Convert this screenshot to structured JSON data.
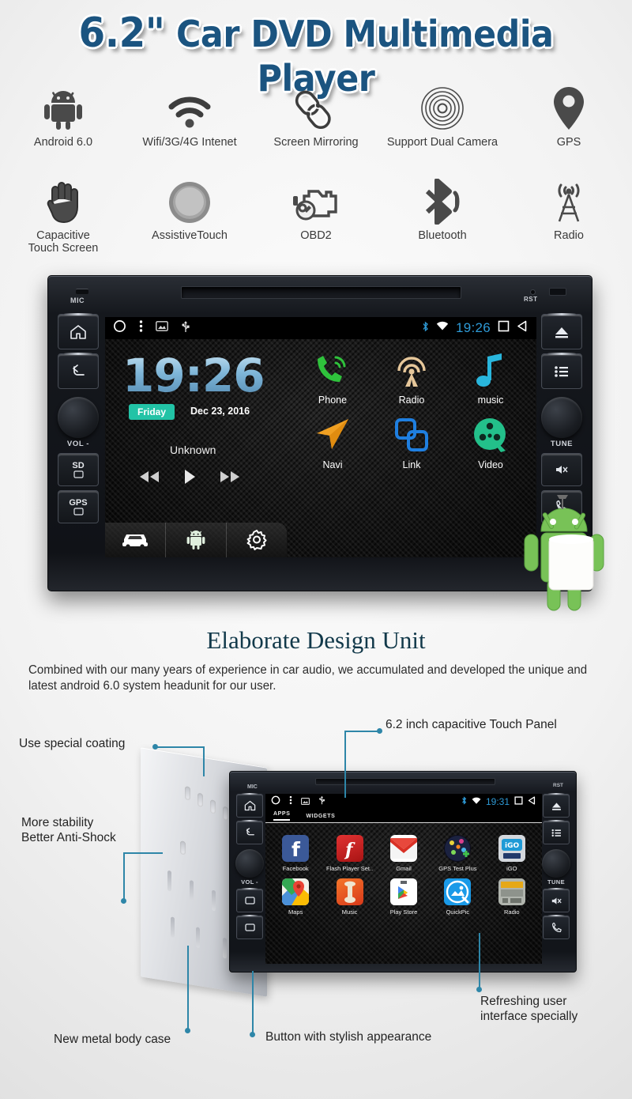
{
  "header": {
    "size": "6.2\"",
    "title": "Car DVD Multimedia Player"
  },
  "features_row1": [
    {
      "icon": "android-robot-icon",
      "label": "Android 6.0"
    },
    {
      "icon": "wifi-icon",
      "label": "Wifi/3G/4G Intenet"
    },
    {
      "icon": "chain-link-icon",
      "label": "Screen Mirroring"
    },
    {
      "icon": "camera-rings-icon",
      "label": "Support Dual Camera"
    },
    {
      "icon": "map-pin-icon",
      "label": "GPS"
    }
  ],
  "features_row2": [
    {
      "icon": "hand-touch-icon",
      "label": "Capacitive\nTouch Screen",
      "line1": "Capacitive",
      "line2": "Touch Screen"
    },
    {
      "icon": "round-button-icon",
      "label": "AssistiveTouch",
      "line1": "AssistiveTouch",
      "line2": ""
    },
    {
      "icon": "engine-wrench-icon",
      "label": "OBD2",
      "line1": "OBD2",
      "line2": ""
    },
    {
      "icon": "bluetooth-icon",
      "label": "Bluetooth",
      "line1": "Bluetooth",
      "line2": ""
    },
    {
      "icon": "radio-tower-icon",
      "label": "Radio",
      "line1": "Radio",
      "line2": ""
    }
  ],
  "device": {
    "mic_label": "MIC",
    "rst_label": "RST",
    "left_buttons": [
      {
        "name": "home-button",
        "icon": "home-icon"
      },
      {
        "name": "back-button",
        "icon": "back-arrow-icon"
      }
    ],
    "left_knob_label": "VOL -",
    "left_slots": [
      {
        "name": "sd-card-slot",
        "label": "SD"
      },
      {
        "name": "gps-slot",
        "label": "GPS"
      }
    ],
    "right_buttons": [
      {
        "name": "eject-button",
        "icon": "eject-icon"
      },
      {
        "name": "list-button",
        "icon": "list-icon"
      }
    ],
    "right_knob_label": "TUNE"
  },
  "screen": {
    "status_bar": {
      "left_icons": [
        "circle-icon",
        "kebab-menu-icon",
        "image-icon",
        "usb-icon"
      ],
      "right_icons": [
        "bluetooth-icon",
        "wifi-icon"
      ],
      "time": "19:26",
      "nav_icons": [
        "square-icon",
        "back-triangle-icon"
      ]
    },
    "clock": "19:26",
    "day_badge": "Friday",
    "date": "Dec 23, 2016",
    "track_name": "Unknown",
    "transport": [
      "rewind-icon",
      "play-icon",
      "forward-icon"
    ],
    "apps": [
      {
        "icon": "phone-handset-icon",
        "label": "Phone",
        "color": "#2fc23c"
      },
      {
        "icon": "radio-waves-icon",
        "label": "Radio",
        "color": "#e6c79a"
      },
      {
        "icon": "music-note-icon",
        "label": "music",
        "color": "#29b6dd"
      },
      {
        "icon": "navigation-arrow-icon",
        "label": "Navi",
        "color": "#f0a022"
      },
      {
        "icon": "link-squares-icon",
        "label": "Link",
        "color": "#1f7fe0"
      },
      {
        "icon": "film-reel-icon",
        "label": "Video",
        "color": "#23c08a"
      }
    ],
    "tabs": [
      {
        "name": "tab-car",
        "icon": "car-icon"
      },
      {
        "name": "tab-android",
        "icon": "android-robot-icon"
      },
      {
        "name": "tab-settings",
        "icon": "gear-icon"
      }
    ]
  },
  "design_section": {
    "title": "Elaborate Design Unit",
    "body": "Combined with our many years of experience in car audio, we accumulated and developed the unique and latest android 6.0 system headunit for our user."
  },
  "exploded": {
    "status_bar": {
      "left_icons": [
        "circle-icon",
        "kebab-menu-icon",
        "image-icon",
        "usb-icon"
      ],
      "right_icons": [
        "bluetooth-icon",
        "wifi-icon"
      ],
      "time": "19:31",
      "nav_icons": [
        "square-icon",
        "back-triangle-icon"
      ]
    },
    "tabs": [
      {
        "label": "APPS",
        "active": true
      },
      {
        "label": "WIDGETS",
        "active": false
      }
    ],
    "apps": [
      {
        "icon": "facebook-icon",
        "label": "Facebook"
      },
      {
        "icon": "flash-player-icon",
        "label": "Flash Player Set.."
      },
      {
        "icon": "gmail-icon",
        "label": "Gmail"
      },
      {
        "icon": "gps-test-plus-icon",
        "label": "GPS Test Plus"
      },
      {
        "icon": "igo-icon",
        "label": "iGO"
      },
      {
        "icon": "google-maps-icon",
        "label": "Maps"
      },
      {
        "icon": "music-app-icon",
        "label": "Music"
      },
      {
        "icon": "play-store-icon",
        "label": "Play Store"
      },
      {
        "icon": "quickpic-icon",
        "label": "QuickPic"
      },
      {
        "icon": "radio-app-icon",
        "label": "Radio"
      }
    ],
    "mic_label": "MIC",
    "rst_label": "RST",
    "knob_left_label": "VOL -",
    "knob_right_label": "TUNE"
  },
  "callouts": {
    "touch_panel": "6.2 inch capacitive Touch Panel",
    "coating": "Use special coating",
    "stability_l1": "More stability",
    "stability_l2": "Better Anti-Shock",
    "metal_case": "New metal body case",
    "button_style": "Button with stylish appearance",
    "ui_l1": "Refreshing user",
    "ui_l2": "interface specially"
  },
  "colors": {
    "title_blue": "#1b5480",
    "callout_teal": "#2e86a8",
    "accent_cyan": "#2e9ad6",
    "badge_teal": "#22c3a6",
    "serif_heading": "#12394a"
  }
}
